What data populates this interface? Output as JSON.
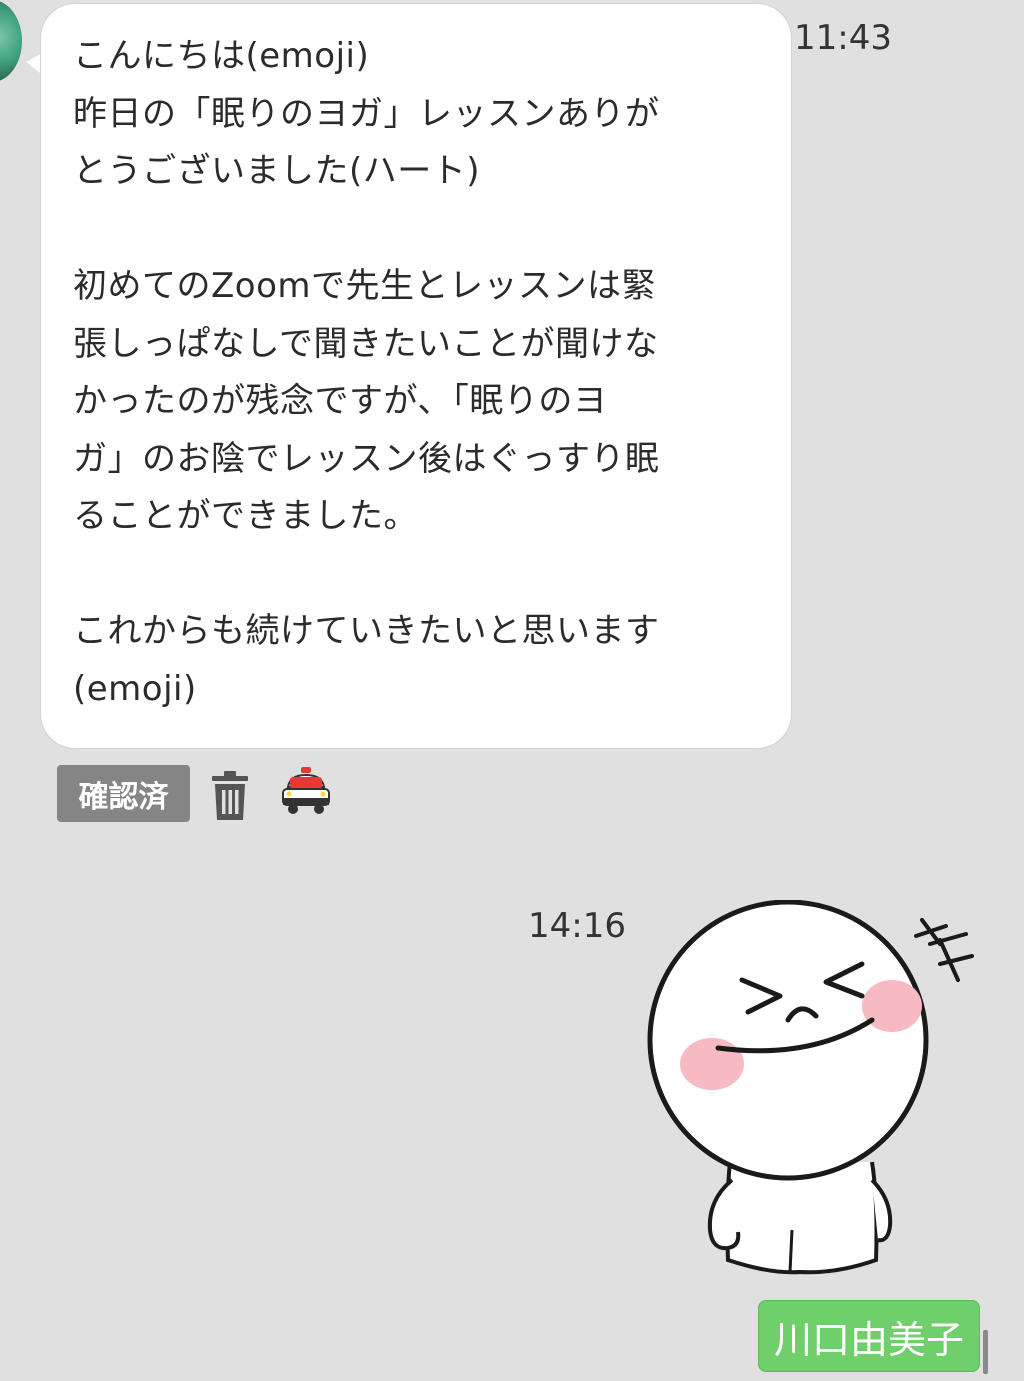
{
  "incoming": {
    "time": "11:43",
    "lines": [
      "こんにちは(emoji)",
      "昨日の「眠りのヨガ」レッスンありが",
      "とうございました(ハート)",
      "",
      "初めてのZoomで先生とレッスンは緊",
      "張しっぱなしで聞きたいことが聞けな",
      "かったのが残念ですが、「眠りのヨ",
      "ガ」のお陰でレッスン後はぐっすり眠",
      "ることができました。",
      "",
      "これからも続けていきたいと思います",
      "(emoji)"
    ],
    "status_badge": "確認済",
    "trash_icon": "trash-icon",
    "report_icon": "police-car-icon"
  },
  "outgoing": {
    "time": "14:16",
    "sticker": "laughing-face-sticker"
  },
  "name_tag": "川口由美子"
}
